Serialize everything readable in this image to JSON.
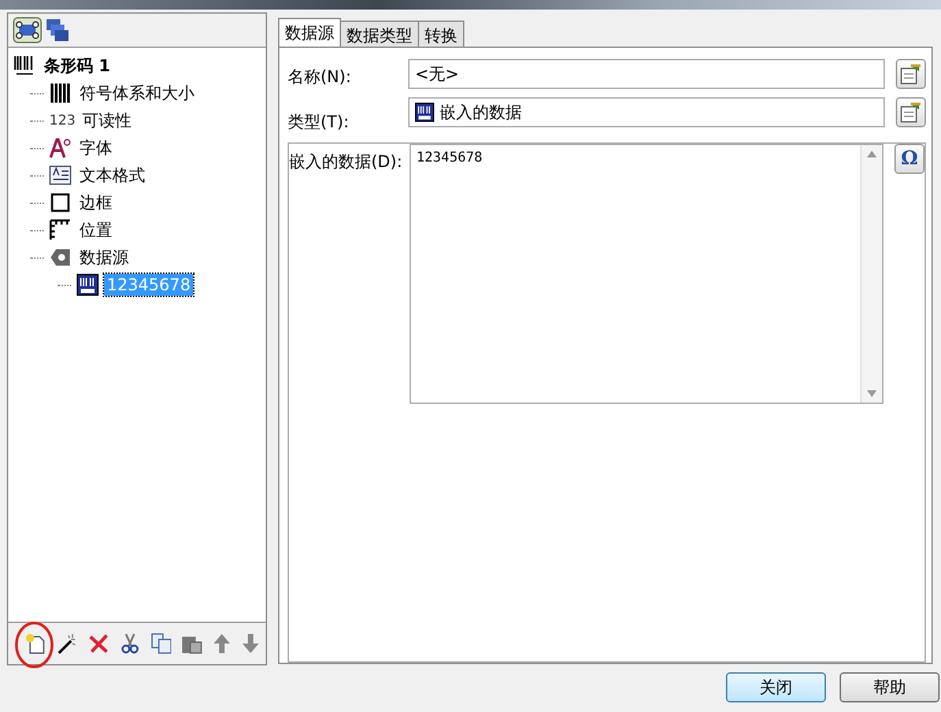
{
  "tree": [
    {
      "label": "条形码 1",
      "kind": "barcode",
      "selected": false,
      "children": [
        {
          "label": "符号体系和大小",
          "kind": "bars",
          "selected": false
        },
        {
          "label": "可读性",
          "kind": "digits",
          "icon_text": "123",
          "selected": false
        },
        {
          "label": "字体",
          "kind": "font",
          "selected": false
        },
        {
          "label": "文本格式",
          "kind": "format",
          "selected": false
        },
        {
          "label": "边框",
          "kind": "border",
          "selected": false
        },
        {
          "label": "位置",
          "kind": "ruler",
          "selected": false
        },
        {
          "label": "数据源",
          "kind": "source",
          "selected": false,
          "children": [
            {
              "label": "12345678",
              "kind": "data",
              "selected": true
            }
          ]
        }
      ]
    }
  ],
  "tabs": [
    {
      "label": "数据源",
      "selected": true
    },
    {
      "label": "数据类型",
      "selected": false
    },
    {
      "label": "转换",
      "selected": false
    }
  ],
  "fields": [
    {
      "label": "名称(N):",
      "value": "<无>",
      "kind": "text"
    },
    {
      "label": "类型(T):",
      "value": "嵌入的数据",
      "kind": "type"
    },
    {
      "label": "嵌入的数据(D):",
      "value": "12345678",
      "kind": "area",
      "button": "Ω"
    }
  ],
  "buttons": [
    {
      "label": "关闭",
      "selected": true
    },
    {
      "label": "帮助",
      "selected": false
    }
  ]
}
